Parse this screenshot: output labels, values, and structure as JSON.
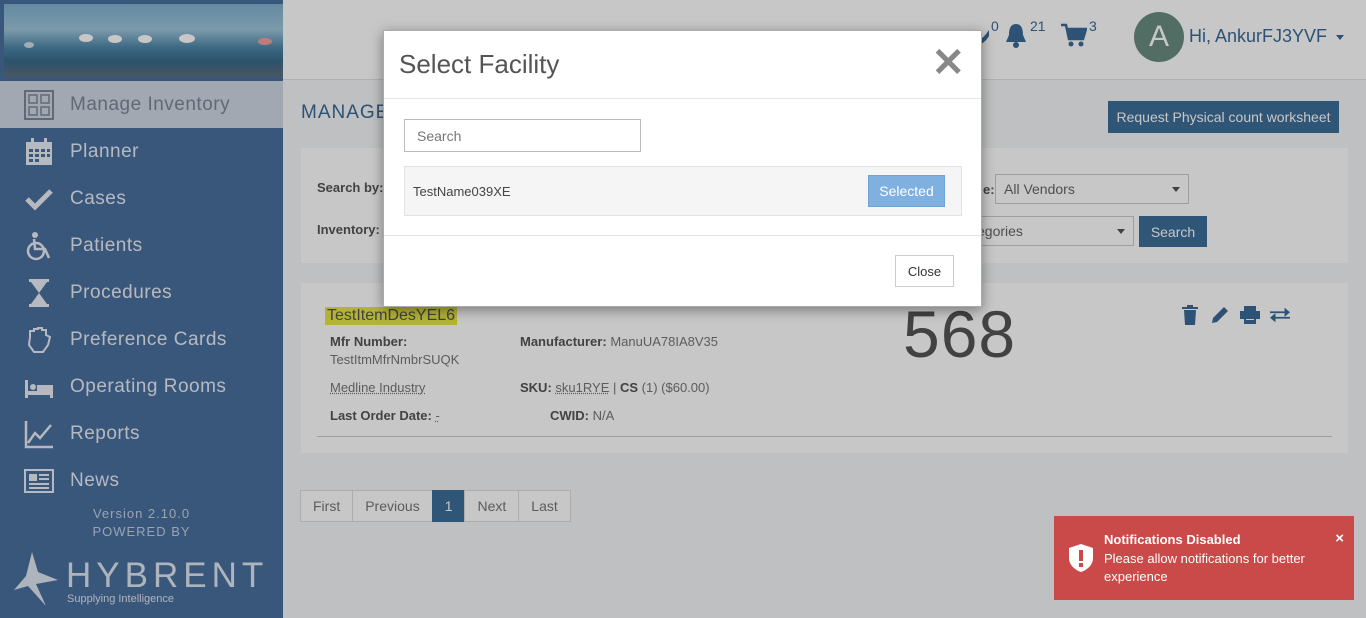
{
  "sidebar": {
    "items": [
      {
        "label": "Manage Inventory",
        "icon": "inventory-grid-icon"
      },
      {
        "label": "Planner",
        "icon": "calendar-icon"
      },
      {
        "label": "Cases",
        "icon": "check-icon"
      },
      {
        "label": "Patients",
        "icon": "wheelchair-icon"
      },
      {
        "label": "Procedures",
        "icon": "hourglass-icon"
      },
      {
        "label": "Preference Cards",
        "icon": "glove-icon"
      },
      {
        "label": "Operating Rooms",
        "icon": "bed-icon"
      },
      {
        "label": "Reports",
        "icon": "line-chart-icon"
      },
      {
        "label": "News",
        "icon": "newspaper-icon"
      }
    ],
    "version": "Version 2.10.0",
    "powered_by": "POWERED BY",
    "brand": "HYBRENT",
    "tagline": "Supplying Intelligence"
  },
  "topbar": {
    "messages_count": "0",
    "notifications_count": "21",
    "cart_count": "3",
    "avatar_letter": "A",
    "greeting": "Hi, AnkurFJ3YVF"
  },
  "main": {
    "page_title": "MANAGE I",
    "request_button": "Request Physical count worksheet",
    "search_by_label": "Search by:",
    "inventory_label": "Inventory:",
    "vendor_label": "e:",
    "vendor_value": "All Vendors",
    "category_value": "egories",
    "search_button": "Search"
  },
  "item": {
    "name": "TestItemDesYEL6",
    "mfr_label": "Mfr Number:",
    "mfr_value": "TestItmMfrNmbrSUQK",
    "manufacturer_label": "Manufacturer:",
    "manufacturer_value": "ManuUA78IA8V35",
    "vendor": "Medline Industry",
    "sku_label": "SKU:",
    "sku_value": "sku1RYE",
    "cs_label": "CS",
    "cs_value": "(1) ($60.00)",
    "last_order_label": "Last Order Date:",
    "last_order_value": "-",
    "cwid_label": "CWID:",
    "cwid_value": "N/A",
    "count": "568"
  },
  "pager": {
    "first": "First",
    "previous": "Previous",
    "current": "1",
    "next": "Next",
    "last": "Last"
  },
  "modal": {
    "title": "Select Facility",
    "search_placeholder": "Search",
    "facility_name": "TestName039XE",
    "selected_label": "Selected",
    "close_label": "Close"
  },
  "toast": {
    "title": "Notifications Disabled",
    "message": "Please allow notifications for better experience",
    "close": "×",
    "color": "#c94a48"
  }
}
